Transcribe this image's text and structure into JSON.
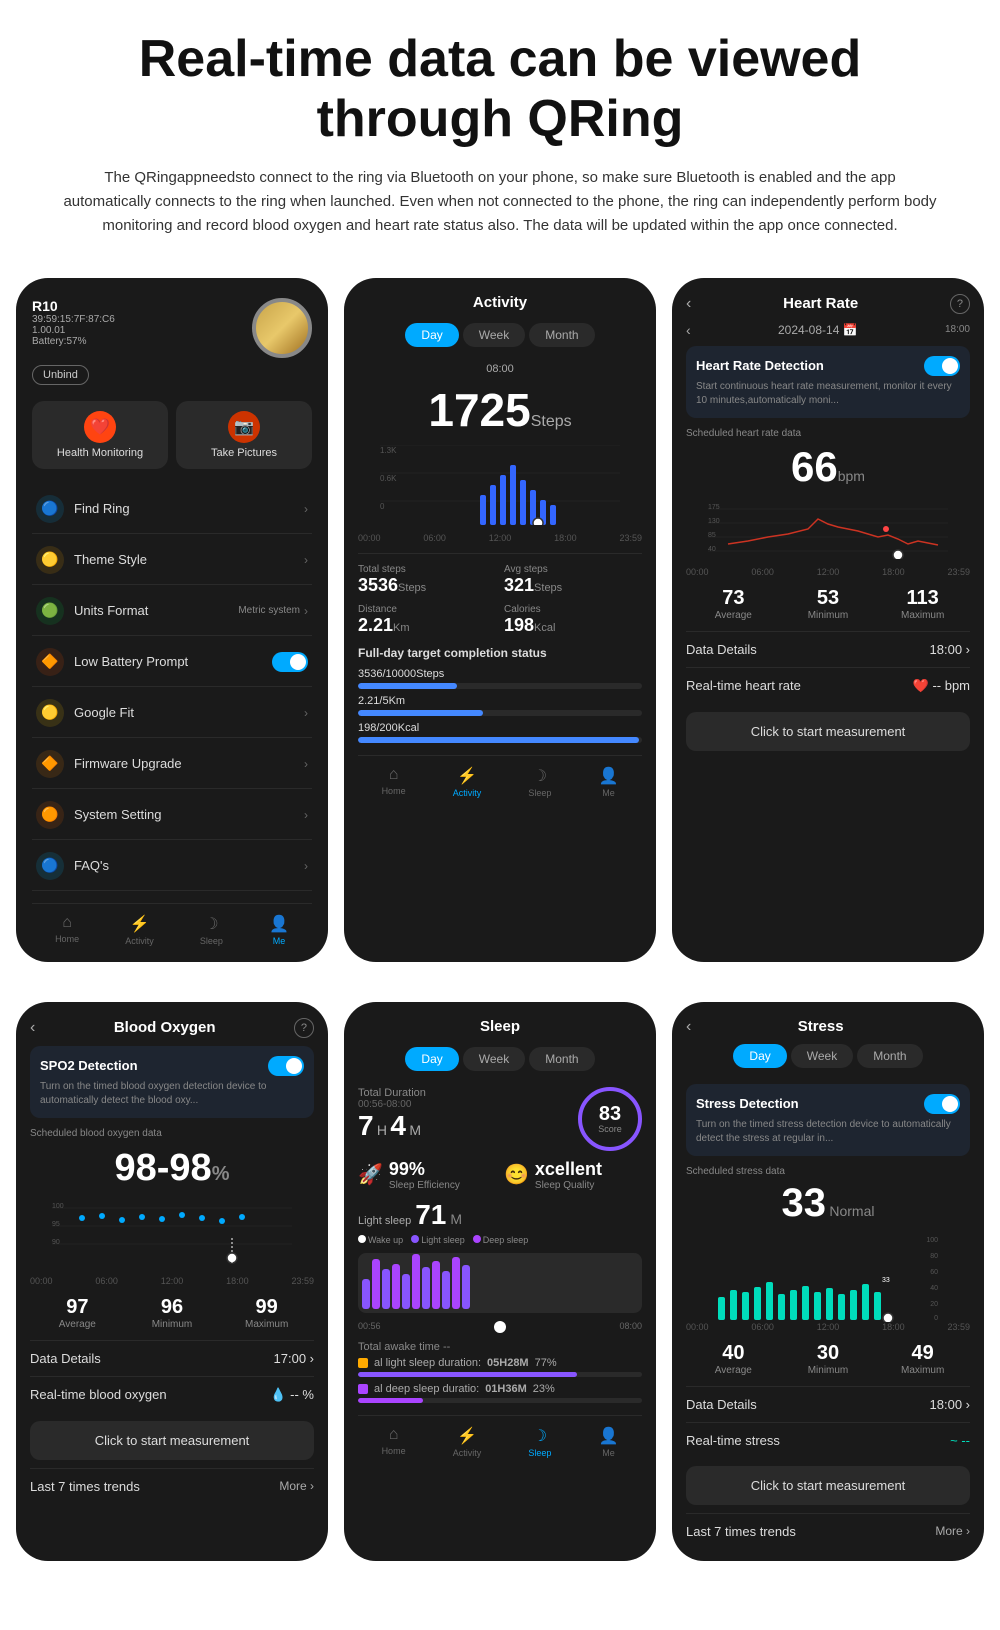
{
  "header": {
    "title": "Real-time data can be viewed through QRing",
    "description": "The QRingappneedsto connect to the ring via Bluetooth on your phone, so make sure Bluetooth is enabled and the app automatically connects to the ring when launched. Even when not connected to the phone, the ring can independently perform body monitoring and record blood oxygen and heart rate status also. The data will be updated within the app once connected."
  },
  "phone1": {
    "device": {
      "name": "R10",
      "id": "39:59:15:7F:87:C6",
      "version": "1.00.01",
      "battery": "Battery:57%"
    },
    "buttons": {
      "unbind": "Unbind"
    },
    "menuIcons": [
      {
        "label": "Health Monitoring",
        "icon": "❤️",
        "color": "#ff6633"
      },
      {
        "label": "Take Pictures",
        "icon": "📷",
        "color": "#ff6633"
      }
    ],
    "menuItems": [
      {
        "label": "Find Ring",
        "icon": "🔵",
        "color": "#00aaff",
        "right": "›"
      },
      {
        "label": "Theme Style",
        "icon": "🟡",
        "color": "#ffaa00",
        "right": "›"
      },
      {
        "label": "Units Format",
        "icon": "🟢",
        "color": "#00cc44",
        "right": "Metric system ›"
      },
      {
        "label": "Low Battery Prompt",
        "icon": "🟠",
        "color": "#ff5500",
        "right": "toggle"
      },
      {
        "label": "Google Fit",
        "icon": "🟡",
        "color": "#ffcc00",
        "right": "›"
      },
      {
        "label": "Firmware Upgrade",
        "icon": "🟠",
        "color": "#ff8800",
        "right": "›"
      },
      {
        "label": "System Setting",
        "icon": "🟠",
        "color": "#ff6600",
        "right": "›"
      },
      {
        "label": "FAQ's",
        "icon": "🔵",
        "color": "#00bbff",
        "right": "›"
      }
    ],
    "nav": [
      {
        "label": "Home",
        "icon": "⌂",
        "active": false
      },
      {
        "label": "Activity",
        "icon": "⚡",
        "active": false
      },
      {
        "label": "Sleep",
        "icon": "☽",
        "active": false
      },
      {
        "label": "Me",
        "icon": "👤",
        "active": true
      }
    ]
  },
  "phone2": {
    "title": "Activity",
    "tabs": [
      "Day",
      "Week",
      "Month"
    ],
    "activeTab": 0,
    "timeLabel": "08:00",
    "steps": "1725",
    "stepsUnit": "Steps",
    "chartYLabels": [
      "1.3K",
      "0.6K",
      "0"
    ],
    "chartXLabels": [
      "00:00",
      "06:00",
      "12:00",
      "18:00",
      "23:59"
    ],
    "totalSteps": {
      "label": "Total steps",
      "value": "3536",
      "unit": "Steps"
    },
    "avgSteps": {
      "label": "Avg steps",
      "value": "321",
      "unit": "Steps"
    },
    "distance": {
      "label": "Distance",
      "value": "2.21",
      "unit": "Km"
    },
    "calories": {
      "label": "Calories",
      "value": "198",
      "unit": "Kcal"
    },
    "target": {
      "title": "Full-day target completion status",
      "items": [
        {
          "text": "3536/10000Steps",
          "percent": 35
        },
        {
          "text": "2.21/5Km",
          "percent": 44
        },
        {
          "text": "198/200Kcal",
          "percent": 99
        }
      ]
    },
    "nav": [
      {
        "label": "Home",
        "icon": "⌂",
        "active": false
      },
      {
        "label": "Activity",
        "icon": "⚡",
        "active": true
      },
      {
        "label": "Sleep",
        "icon": "☽",
        "active": false
      },
      {
        "label": "Me",
        "icon": "👤",
        "active": false
      }
    ]
  },
  "phone3": {
    "title": "Heart Rate",
    "date": "2024-08-14",
    "timeLabel": "18:00",
    "detection": {
      "title": "Heart Rate Detection",
      "description": "Start continuous heart rate measurement, monitor it every 10 minutes,automatically moni..."
    },
    "scheduledLabel": "Scheduled heart rate data",
    "bpm": "66",
    "bpmUnit": "bpm",
    "chartYLabels": [
      "175",
      "130",
      "85",
      "40"
    ],
    "chartXLabels": [
      "00:00",
      "06:00",
      "12:00",
      "18:00",
      "23:59"
    ],
    "metrics": [
      {
        "value": "73",
        "label": "Average"
      },
      {
        "value": "53",
        "label": "Minimum"
      },
      {
        "value": "113",
        "label": "Maximum"
      }
    ],
    "dataDetails": {
      "label": "Data Details",
      "time": "18:00"
    },
    "realtimeLabel": "Real-time heart rate",
    "measureBtn": "Click to start measurement"
  },
  "phone4": {
    "title": "Blood Oxygen",
    "detection": {
      "title": "SPO2 Detection",
      "description": "Turn on the timed blood oxygen detection device to automatically detect the blood oxy..."
    },
    "scheduledLabel": "Scheduled blood oxygen data",
    "spo2": "98-98",
    "spo2Unit": "%",
    "chartYLabels": [
      "100",
      "95",
      "90"
    ],
    "chartXLabels": [
      "00:00",
      "06:00",
      "12:00",
      "18:00",
      "23:59"
    ],
    "metrics": [
      {
        "value": "97",
        "label": "Average"
      },
      {
        "value": "96",
        "label": "Minimum"
      },
      {
        "value": "99",
        "label": "Maximum"
      }
    ],
    "dataDetails": {
      "label": "Data Details",
      "time": "17:00"
    },
    "realtimeLabel": "Real-time blood oxygen",
    "measureBtn": "Click to start measurement",
    "lastTrends": "Last 7 times trends",
    "more": "More >"
  },
  "phone5": {
    "title": "Sleep",
    "tabs": [
      "Day",
      "Week",
      "Month"
    ],
    "activeTab": 0,
    "totalDuration": "Total Duration",
    "sleepHours": "7",
    "sleepMins": "4",
    "sleepTimeRange": "00:56-08:00",
    "score": "83",
    "scoreLabel": "Score",
    "efficiency": {
      "value": "99%",
      "label": "Sleep Efficiency"
    },
    "quality": {
      "value": "xcellent",
      "label": "Sleep Quality"
    },
    "lightSleep": {
      "label": "Light sleep",
      "value": "71",
      "unit": "M"
    },
    "legend": [
      {
        "label": "Wake up",
        "color": "#ffffff"
      },
      {
        "label": "Light sleep",
        "color": "#8855ff"
      },
      {
        "label": "Deep sleep",
        "color": "#aa44ff"
      }
    ],
    "timeLabels": [
      "00:56",
      "08:00"
    ],
    "sleepTotals": [
      {
        "label": "al light sleep duration:",
        "value": "05H28M",
        "percent": "77%",
        "color": "#8855ff",
        "fill": 77
      },
      {
        "label": "al deep sleep duration:",
        "value": "01H36M",
        "percent": "23%",
        "color": "#aa00ff",
        "fill": 23
      }
    ],
    "nav": [
      {
        "label": "Home",
        "icon": "⌂",
        "active": false
      },
      {
        "label": "Activity",
        "icon": "⚡",
        "active": false
      },
      {
        "label": "Sleep",
        "icon": "☽",
        "active": true
      },
      {
        "label": "Me",
        "icon": "👤",
        "active": false
      }
    ]
  },
  "phone6": {
    "title": "Stress",
    "tabs": [
      "Day",
      "Week",
      "Month"
    ],
    "activeTab": 0,
    "detection": {
      "title": "Stress Detection",
      "description": "Turn on the timed stress detection device to automatically detect the stress at regular in..."
    },
    "scheduledLabel": "Scheduled stress data",
    "stress": "33",
    "stressLabel": "Normal",
    "chartYLabels": [
      "100",
      "80",
      "60",
      "40",
      "20",
      "0"
    ],
    "chartXLabels": [
      "00:00",
      "06:00",
      "12:00",
      "18:00",
      "23:59"
    ],
    "metrics": [
      {
        "value": "40",
        "label": "Average"
      },
      {
        "value": "30",
        "label": "Minimum"
      },
      {
        "value": "49",
        "label": "Maximum"
      }
    ],
    "dataDetails": {
      "label": "Data Details",
      "time": "18:00"
    },
    "realtimeLabel": "Real-time stress",
    "measureBtn": "Click to start measurement",
    "lastTrends": "Last 7 times trends",
    "more": "More >"
  }
}
